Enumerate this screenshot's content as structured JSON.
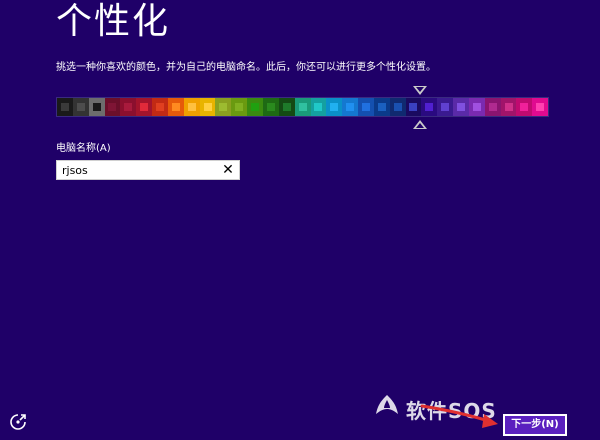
{
  "page": {
    "title": "个性化",
    "description": "挑选一种你喜欢的颜色，并为自己的电脑命名。此后，你还可以进行更多个性化设置。"
  },
  "colors": {
    "background": "#1f0068",
    "swatches": [
      {
        "bg": "#1a1a1a",
        "inner": "#3a3a3a"
      },
      {
        "bg": "#333333",
        "inner": "#4d4d4d"
      },
      {
        "bg": "#6d6d6d",
        "inner": "#1a1a1a"
      },
      {
        "bg": "#6b0f2a",
        "inner": "#7f1535"
      },
      {
        "bg": "#8b0f2e",
        "inner": "#a81a3c"
      },
      {
        "bg": "#a3142c",
        "inner": "#e02a3a"
      },
      {
        "bg": "#c22a14",
        "inner": "#e04020"
      },
      {
        "bg": "#e65a0a",
        "inner": "#ff8a20"
      },
      {
        "bg": "#f0a000",
        "inner": "#ffc040"
      },
      {
        "bg": "#e8b400",
        "inner": "#ffd040"
      },
      {
        "bg": "#8aa020",
        "inner": "#9dbb30"
      },
      {
        "bg": "#6a9a10",
        "inner": "#80b020"
      },
      {
        "bg": "#3a8a10",
        "inner": "#20a010"
      },
      {
        "bg": "#1e6a14",
        "inner": "#2a8a1e"
      },
      {
        "bg": "#144a14",
        "inner": "#1e7a2a"
      },
      {
        "bg": "#1a9a7a",
        "inner": "#30c0a0"
      },
      {
        "bg": "#14a0a0",
        "inner": "#20c8c8"
      },
      {
        "bg": "#0a90c8",
        "inner": "#20b0f0"
      },
      {
        "bg": "#1478d0",
        "inner": "#2090f0"
      },
      {
        "bg": "#1450b0",
        "inner": "#2070e0"
      },
      {
        "bg": "#0a3a8a",
        "inner": "#1a60c0"
      },
      {
        "bg": "#102a70",
        "inner": "#1a50b0"
      },
      {
        "bg": "#1a0a60",
        "inner": "#3a40c0"
      },
      {
        "bg": "#2a0a80",
        "inner": "#5020d0"
      },
      {
        "bg": "#3a1a90",
        "inner": "#6040d0"
      },
      {
        "bg": "#5a2aa8",
        "inner": "#8050e0"
      },
      {
        "bg": "#7a2ab0",
        "inner": "#a050e0"
      },
      {
        "bg": "#8a1470",
        "inner": "#b02a90"
      },
      {
        "bg": "#a0146a",
        "inner": "#d0308a"
      },
      {
        "bg": "#c00a70",
        "inner": "#f0209a"
      },
      {
        "bg": "#e00a90",
        "inner": "#ff40b0"
      }
    ],
    "selected_index": 22,
    "button_bg": "#5a1fbf"
  },
  "name_field": {
    "label": "电脑名称(A)",
    "value": "rjsos",
    "clear_glyph": "✕"
  },
  "footer": {
    "next_label": "下一步(N)",
    "accessibility_icon": "ease-of-access-icon",
    "watermark_text": "软件SOS"
  }
}
